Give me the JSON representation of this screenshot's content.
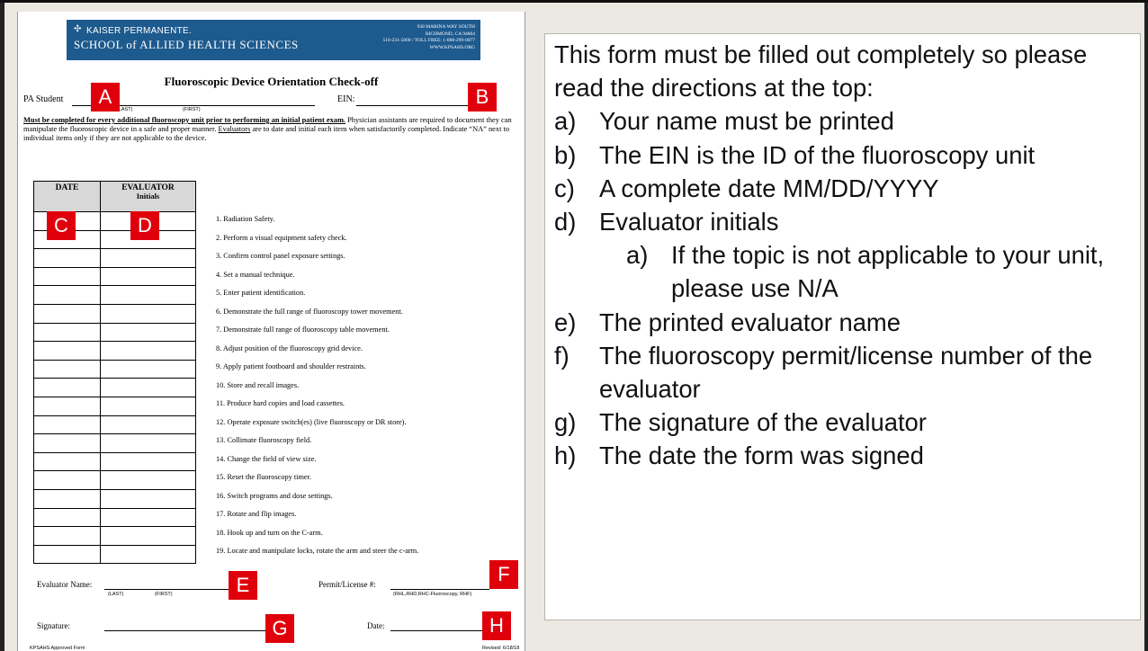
{
  "form": {
    "org_line1": "KAISER PERMANENTE.",
    "org_line2": "SCHOOL of ALLIED HEALTH SCIENCES",
    "address": [
      "938 MARINA WAY SOUTH",
      "RICHMOND, CA 94804",
      "510-231-5000 / TOLL FREE: 1-888-299-0077",
      "WWW.KPSAHS.ORG"
    ],
    "title": "Fluoroscopic Device Orientation Check-off",
    "pa_label": "PA Student",
    "last_label": "(LAST)",
    "first_label": "(FIRST)",
    "ein_label": "EIN:",
    "instr_bold": "Must be completed for every additional fluoroscopy unit prior to performing an initial patient exam.",
    "instr_rest1": " Physician assistants are required to document they can manipulate the fluoroscopic device in a safe and proper manner.",
    "instr_evaluators": "Evaluators",
    "instr_rest2": " are to date and initial each item when satisfactorily completed. Indicate “NA” next to individual items only if they are not applicable to the device.",
    "col_date": "DATE",
    "col_evaluator": "EVALUATOR",
    "col_initials": "Initials",
    "items": [
      "1.   Radiation Safety.",
      "2.   Perform a visual equipment safety check.",
      "3.   Confirm control panel exposure settings.",
      "4.   Set a manual technique.",
      "5.   Enter patient identification.",
      "6.   Demonstrate the full range of fluoroscopy tower movement.",
      "7.   Demonstrate full range of fluoroscopy table movement.",
      "8.   Adjust position of the fluoroscopy grid device.",
      "9.   Apply patient footboard and shoulder restraints.",
      "10.  Store and recall images.",
      "11. Produce hard copies and load cassettes.",
      "12. Operate exposure switch(es) (live fluoroscopy or DR store).",
      "13. Collimate fluoroscopy field.",
      "14. Change the field of view size.",
      "15. Reset the fluoroscopy timer.",
      "16. Switch programs and dose settings.",
      "17. Rotate and flip images.",
      "18. Hook up and turn on the C-arm.",
      "19. Locate and manipulate locks, rotate the arm and steer the c-arm."
    ],
    "evaluator_name_label": "Evaluator Name:",
    "permit_label": "Permit/License #:",
    "permit_note": "(RHL,RHD,RHC-Fluoroscopy, RHF)",
    "signature_label": "Signature:",
    "date_label": "Date:",
    "approved_note": "KPSAHS Approved Form",
    "revised_note": "Revised: 6/18/18"
  },
  "markers": {
    "a": "A",
    "b": "B",
    "c": "C",
    "d": "D",
    "e": "E",
    "f": "F",
    "g": "G",
    "h": "H"
  },
  "panel": {
    "intro": "This form must be filled out completely so please read the directions at the top:",
    "items": [
      {
        "label": "a)",
        "text": "Your name must be printed"
      },
      {
        "label": "b)",
        "text": "The EIN is the ID of the fluoroscopy unit"
      },
      {
        "label": "c)",
        "text": "A complete date MM/DD/YYYY"
      },
      {
        "label": "d)",
        "text": "Evaluator initials"
      },
      {
        "label": "a)",
        "text": "If the topic is not applicable to your unit, please use N/A",
        "sub": true
      },
      {
        "label": "e)",
        "text": "The printed evaluator name"
      },
      {
        "label": "f)",
        "text": "The fluoroscopy permit/license number of the evaluator"
      },
      {
        "label": "g)",
        "text": "The signature of the evaluator"
      },
      {
        "label": "h)",
        "text": "The date the form was signed"
      }
    ]
  },
  "colors": {
    "marker": "#e0000c",
    "banner": "#1d5a8e",
    "background": "#ece9e2"
  }
}
